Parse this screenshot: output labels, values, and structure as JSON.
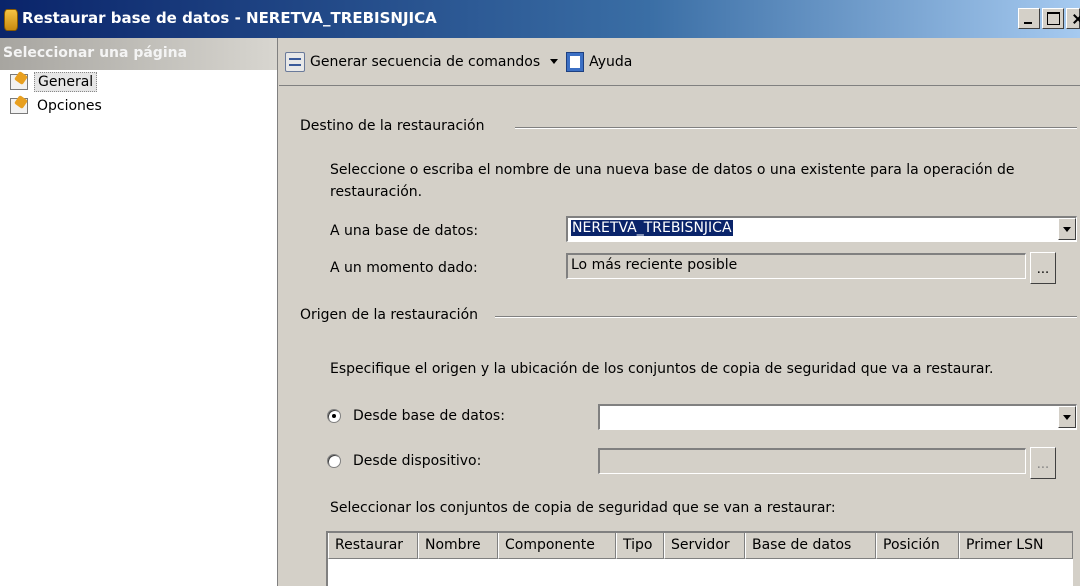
{
  "window": {
    "title": "Restaurar base de datos - NERETVA_TREBISNJICA"
  },
  "sidebar": {
    "header": "Seleccionar una página",
    "items": [
      {
        "label": "General"
      },
      {
        "label": "Opciones"
      }
    ]
  },
  "toolbar": {
    "script_label": "Generar secuencia de comandos",
    "help_label": "Ayuda"
  },
  "destination": {
    "section_title": "Destino de la restauración",
    "description": "Seleccione o escriba el nombre de una nueva base de datos o una existente para la operación de restauración.",
    "database_label": "A una base de datos:",
    "database_value": "NERETVA_TREBISNJICA",
    "point_in_time_label": "A un momento dado:",
    "point_in_time_value": "Lo más reciente posible",
    "ellipsis": "..."
  },
  "source": {
    "section_title": "Origen de la restauración",
    "description": "Especifique el origen y la ubicación de los conjuntos de copia de seguridad que va a restaurar.",
    "from_database_label": "Desde base de datos:",
    "from_database_value": "",
    "from_device_label": "Desde dispositivo:",
    "from_device_value": "",
    "ellipsis": "...",
    "selected_option": "from_database"
  },
  "backup_sets": {
    "label": "Seleccionar los conjuntos de copia de seguridad que se van a restaurar:",
    "columns": [
      "Restaurar",
      "Nombre",
      "Componente",
      "Tipo",
      "Servidor",
      "Base de datos",
      "Posición",
      "Primer LSN"
    ]
  }
}
